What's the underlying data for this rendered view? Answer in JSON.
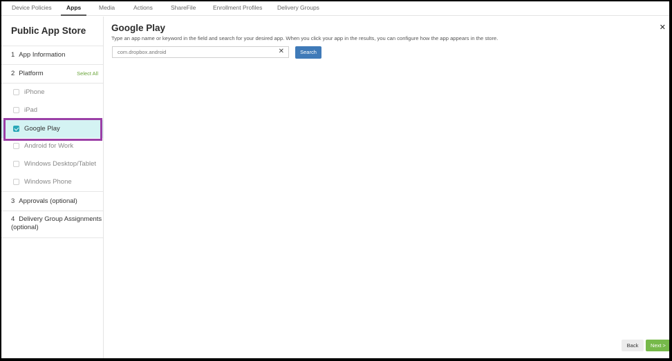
{
  "tabs": [
    {
      "label": "Device Policies"
    },
    {
      "label": "Apps",
      "active": true
    },
    {
      "label": "Media"
    },
    {
      "label": "Actions"
    },
    {
      "label": "ShareFile"
    },
    {
      "label": "Enrollment Profiles"
    },
    {
      "label": "Delivery Groups"
    }
  ],
  "sidebar": {
    "title": "Public App Store",
    "steps": [
      {
        "num": "1",
        "label": "App Information"
      },
      {
        "num": "2",
        "label": "Platform",
        "select_all": "Select All"
      },
      {
        "num": "3",
        "label": "Approvals (optional)"
      },
      {
        "num": "4",
        "label": "Delivery Group Assignments (optional)"
      }
    ],
    "platforms": [
      {
        "label": "iPhone",
        "checked": false
      },
      {
        "label": "iPad",
        "checked": false
      },
      {
        "label": "Google Play",
        "checked": true
      },
      {
        "label": "Android for Work",
        "checked": false
      },
      {
        "label": "Windows Desktop/Tablet",
        "checked": false
      },
      {
        "label": "Windows Phone",
        "checked": false
      }
    ]
  },
  "main": {
    "title": "Google Play",
    "description": "Type an app name or keyword in the field and search for your desired app. When you click your app in the results, you can configure how the app appears in the store.",
    "search": {
      "value": "com.dropbox.android",
      "button_label": "Search"
    },
    "close_icon": "close-icon",
    "footer": {
      "back_label": "Back",
      "next_label": "Next >"
    }
  },
  "colors": {
    "accent_green": "#76b94a",
    "search_blue": "#3f7ab8",
    "selected_row": "#d4f3f3",
    "highlight_border": "#9b3fa6",
    "checkbox_teal": "#2aa8b8"
  }
}
